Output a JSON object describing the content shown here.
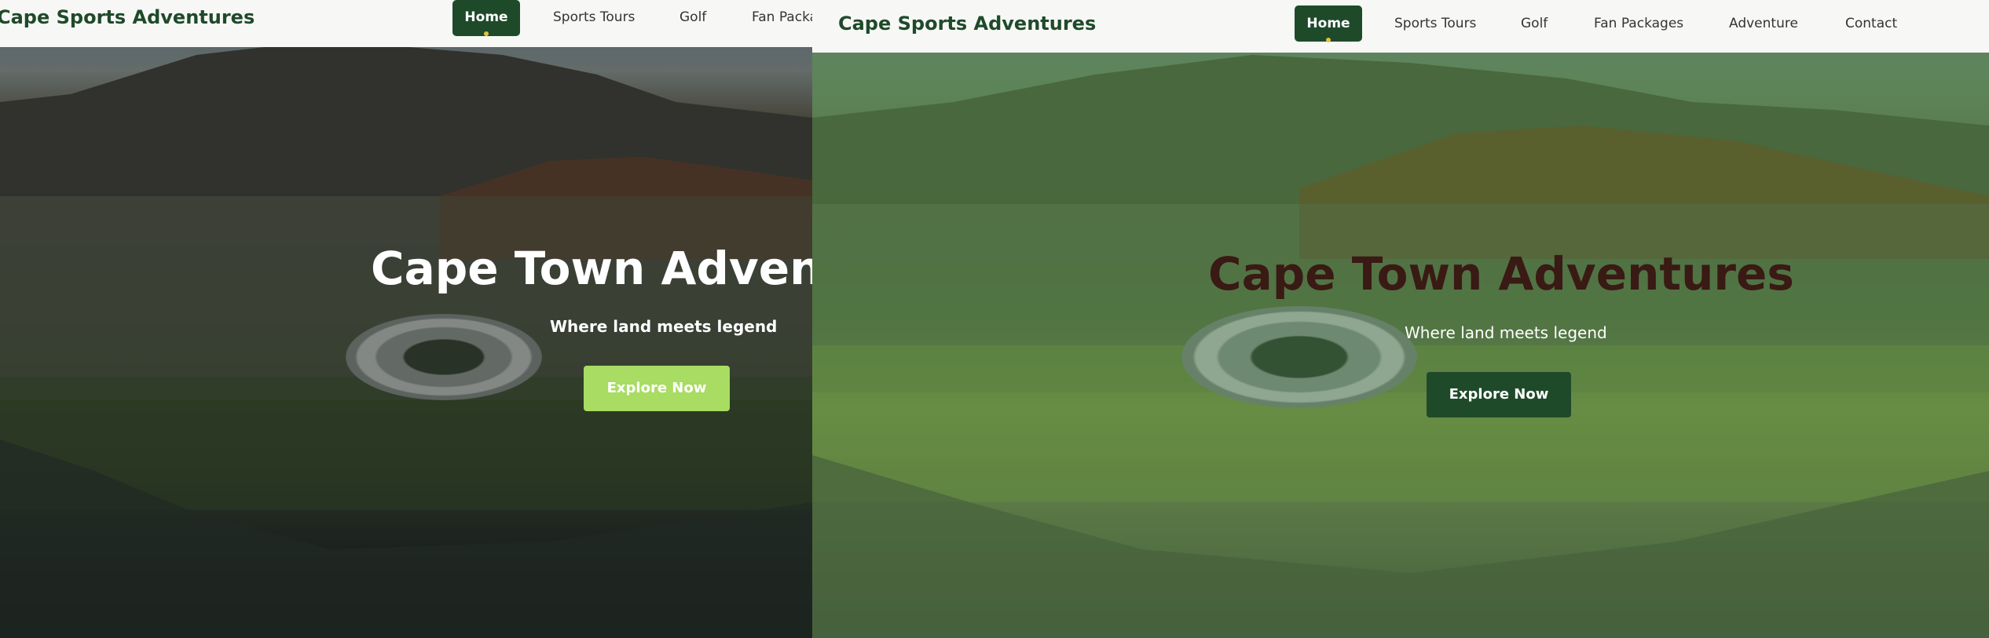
{
  "brand": "Cape Sports Adventures",
  "nav": {
    "home": "Home",
    "sports_tours": "Sports Tours",
    "golf": "Golf",
    "fan_packages": "Fan Packages",
    "fan_packages_clipped": "Fan Packa",
    "adventure": "Adventure",
    "contact": "Contact"
  },
  "hero": {
    "title": "Cape Town Adventures",
    "title_clipped": "Cape Town Adven",
    "subtitle": "Where land meets legend",
    "cta": "Explore Now"
  },
  "colors": {
    "brand_green": "#1f4a2a",
    "accent_yellow": "#e6c23a",
    "cta_light_green": "#a8dc62",
    "title_dark": "#3a1a14"
  },
  "icons": {
    "active_indicator": "nav-active-dot"
  }
}
